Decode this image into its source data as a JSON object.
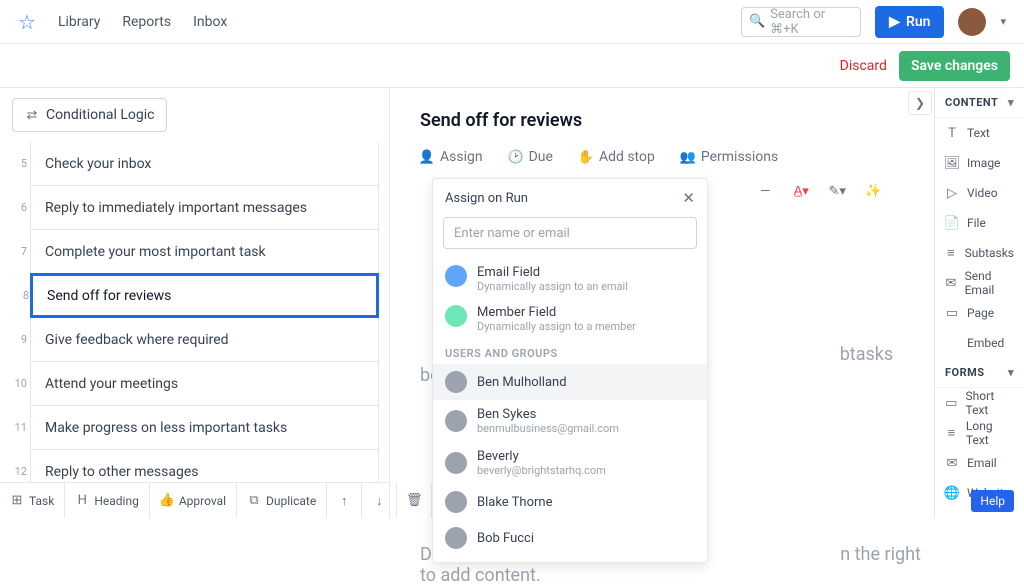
{
  "nav": {
    "library": "Library",
    "reports": "Reports",
    "inbox": "Inbox"
  },
  "search_placeholder": "Search or ⌘+K",
  "run_btn": "Run",
  "discard": "Discard",
  "save": "Save changes",
  "conditional_logic": "Conditional Logic",
  "steps": [
    {
      "n": "5",
      "t": "Check your inbox"
    },
    {
      "n": "6",
      "t": "Reply to immediately important messages"
    },
    {
      "n": "7",
      "t": "Complete your most important task"
    },
    {
      "n": "8",
      "t": "Send off for reviews"
    },
    {
      "n": "9",
      "t": "Give feedback where required"
    },
    {
      "n": "10",
      "t": "Attend your meetings"
    },
    {
      "n": "11",
      "t": "Make progress on less important tasks"
    },
    {
      "n": "12",
      "t": "Reply to other messages"
    }
  ],
  "selected_step": 3,
  "bottom_tb": {
    "task": "Task",
    "heading": "Heading",
    "approval": "Approval",
    "duplicate": "Duplicate"
  },
  "page_title": "Send off for reviews",
  "meta": {
    "assign": "Assign",
    "due": "Due",
    "stop": "Add stop",
    "perm": "Permissions"
  },
  "body_hint_partial": "btasks below, then send them a",
  "drag_hint_partial_a": "Dra",
  "drag_hint_partial_b": "n the right to add content.",
  "popup": {
    "title": "Assign on Run",
    "placeholder": "Enter name or email",
    "email_field": "Email Field",
    "email_sub": "Dynamically assign to an email",
    "member_field": "Member Field",
    "member_sub": "Dynamically assign to a member",
    "section": "USERS AND GROUPS",
    "users": [
      {
        "name": "Ben Mulholland",
        "sub": ""
      },
      {
        "name": "Ben Sykes",
        "sub": "benmulbusiness@gmail.com"
      },
      {
        "name": "Beverly",
        "sub": "beverly@brightstarhq.com"
      },
      {
        "name": "Blake Thorne",
        "sub": ""
      },
      {
        "name": "Bob Fucci",
        "sub": ""
      }
    ]
  },
  "right": {
    "content": "CONTENT",
    "items": [
      "Text",
      "Image",
      "Video",
      "File",
      "Subtasks",
      "Send Email",
      "Page",
      "Embed"
    ],
    "forms": "FORMS",
    "form_items": [
      "Short Text",
      "Long Text",
      "Email",
      "Website"
    ]
  },
  "help": "Help"
}
